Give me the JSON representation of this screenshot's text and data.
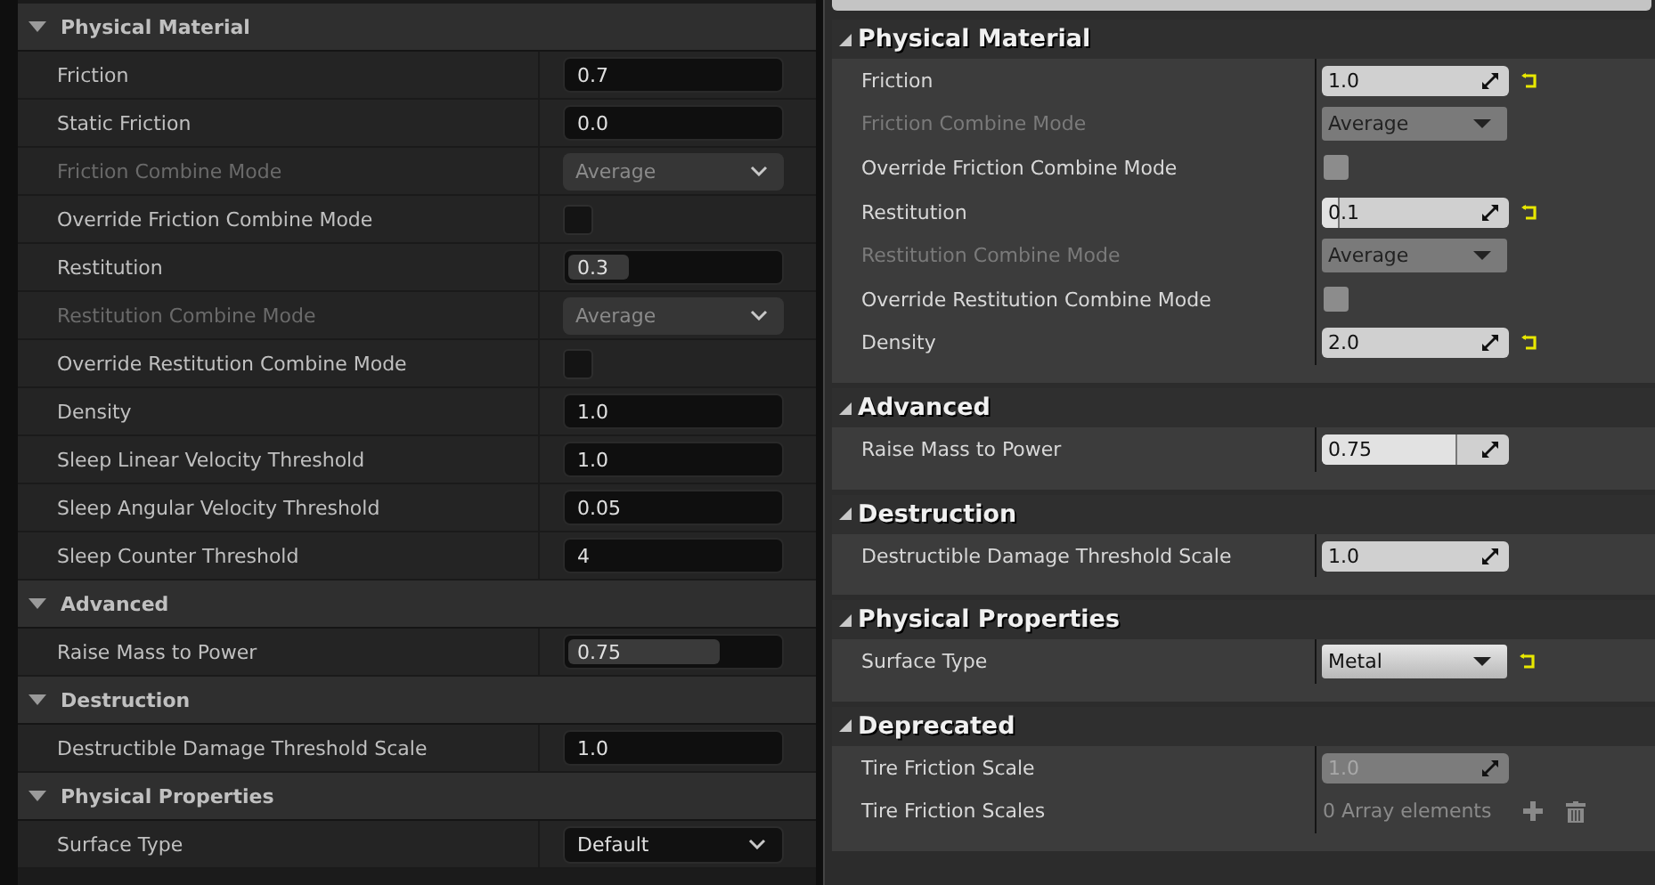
{
  "panels": [
    {
      "kind": "modern",
      "sections": [
        {
          "title": "Physical Material",
          "expanded": true,
          "rows": [
            {
              "kind": "number",
              "label": "Friction",
              "value": "0.7",
              "label_dimmed": false,
              "disabled": false,
              "reset": false
            },
            {
              "kind": "number",
              "label": "Static Friction",
              "value": "0.0",
              "label_dimmed": false,
              "disabled": false,
              "reset": false
            },
            {
              "kind": "dropdown",
              "label": "Friction Combine Mode",
              "value": "Average",
              "label_dimmed": true,
              "disabled": true,
              "reset": false
            },
            {
              "kind": "checkbox",
              "label": "Override Friction Combine Mode",
              "checked": false,
              "label_dimmed": false,
              "disabled": false,
              "reset": false
            },
            {
              "kind": "number",
              "label": "Restitution",
              "value": "0.3",
              "level": 0.28,
              "label_dimmed": false,
              "disabled": false,
              "reset": false
            },
            {
              "kind": "dropdown",
              "label": "Restitution Combine Mode",
              "value": "Average",
              "label_dimmed": true,
              "disabled": true,
              "reset": false
            },
            {
              "kind": "checkbox",
              "label": "Override Restitution Combine Mode",
              "checked": false,
              "label_dimmed": false,
              "disabled": false,
              "reset": false
            },
            {
              "kind": "number",
              "label": "Density",
              "value": "1.0",
              "label_dimmed": false,
              "disabled": false,
              "reset": false
            },
            {
              "kind": "number",
              "label": "Sleep Linear Velocity Threshold",
              "value": "1.0",
              "label_dimmed": false,
              "disabled": false,
              "reset": false
            },
            {
              "kind": "number",
              "label": "Sleep Angular Velocity Threshold",
              "value": "0.05",
              "label_dimmed": false,
              "disabled": false,
              "reset": false
            },
            {
              "kind": "number",
              "label": "Sleep Counter Threshold",
              "value": "4",
              "label_dimmed": false,
              "disabled": false,
              "reset": false
            }
          ]
        },
        {
          "title": "Advanced",
          "expanded": true,
          "rows": [
            {
              "kind": "number",
              "label": "Raise Mass to Power",
              "value": "0.75",
              "level": 0.7,
              "label_dimmed": false,
              "disabled": false,
              "reset": false
            }
          ]
        },
        {
          "title": "Destruction",
          "expanded": true,
          "rows": [
            {
              "kind": "number",
              "label": "Destructible Damage Threshold Scale",
              "value": "1.0",
              "label_dimmed": false,
              "disabled": false,
              "reset": false
            }
          ]
        },
        {
          "title": "Physical Properties",
          "expanded": true,
          "rows": [
            {
              "kind": "dropdown",
              "label": "Surface Type",
              "value": "Default",
              "label_dimmed": false,
              "disabled": false,
              "reset": false
            }
          ]
        }
      ]
    },
    {
      "kind": "legacy",
      "sections": [
        {
          "title": "Physical Material",
          "expanded": true,
          "rows": [
            {
              "kind": "number",
              "label": "Friction",
              "value": "1.0",
              "label_dimmed": false,
              "disabled": false,
              "reset": true
            },
            {
              "kind": "dropdown",
              "label": "Friction Combine Mode",
              "value": "Average",
              "label_dimmed": true,
              "disabled": true,
              "reset": false
            },
            {
              "kind": "checkbox",
              "label": "Override Friction Combine Mode",
              "checked": false,
              "label_dimmed": false,
              "disabled": false,
              "reset": false
            },
            {
              "kind": "number",
              "label": "Restitution",
              "value": "0.1",
              "level": 0.09,
              "label_dimmed": false,
              "disabled": false,
              "reset": true
            },
            {
              "kind": "dropdown",
              "label": "Restitution Combine Mode",
              "value": "Average",
              "label_dimmed": true,
              "disabled": true,
              "reset": false
            },
            {
              "kind": "checkbox",
              "label": "Override Restitution Combine Mode",
              "checked": false,
              "label_dimmed": false,
              "disabled": false,
              "reset": false
            },
            {
              "kind": "number",
              "label": "Density",
              "value": "2.0",
              "label_dimmed": false,
              "disabled": false,
              "reset": true
            }
          ]
        },
        {
          "title": "Advanced",
          "expanded": true,
          "rows": [
            {
              "kind": "number",
              "label": "Raise Mass to Power",
              "value": "0.75",
              "level": 0.72,
              "label_dimmed": false,
              "disabled": false,
              "reset": false
            }
          ]
        },
        {
          "title": "Destruction",
          "expanded": true,
          "rows": [
            {
              "kind": "number",
              "label": "Destructible Damage Threshold Scale",
              "value": "1.0",
              "label_dimmed": false,
              "disabled": false,
              "reset": false
            }
          ]
        },
        {
          "title": "Physical Properties",
          "expanded": true,
          "rows": [
            {
              "kind": "dropdown",
              "label": "Surface Type",
              "value": "Metal",
              "label_dimmed": false,
              "disabled": false,
              "reset": true
            }
          ]
        },
        {
          "title": "Deprecated",
          "expanded": true,
          "rows": [
            {
              "kind": "number",
              "label": "Tire Friction Scale",
              "value": "1.0",
              "label_dimmed": false,
              "disabled": true,
              "reset": false
            },
            {
              "kind": "array",
              "label": "Tire Friction Scales",
              "value": "0 Array elements",
              "label_dimmed": false,
              "disabled": false,
              "reset": false
            }
          ]
        }
      ]
    }
  ]
}
